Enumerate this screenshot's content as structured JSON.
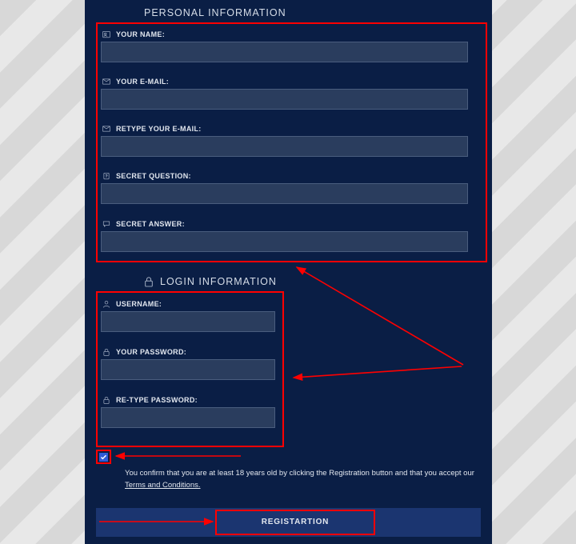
{
  "section_personal": "PERSONAL INFORMATION",
  "section_login": "LOGIN INFORMATION",
  "fields": {
    "name_label": "YOUR NAME:",
    "email_label": "YOUR E-MAIL:",
    "retype_email_label": "RETYPE YOUR E-MAIL:",
    "secret_question_label": "SECRET QUESTION:",
    "secret_answer_label": "SECRET ANSWER:",
    "username_label": "USERNAME:",
    "password_label": "YOUR PASSWORD:",
    "retype_password_label": "RE-TYPE PASSWORD:"
  },
  "confirm": {
    "prefix": "You confirm that you are at least 18 years old by clicking the Registration button and that you accept our ",
    "terms": "Terms and Conditions."
  },
  "button_register": "REGISTARTION"
}
